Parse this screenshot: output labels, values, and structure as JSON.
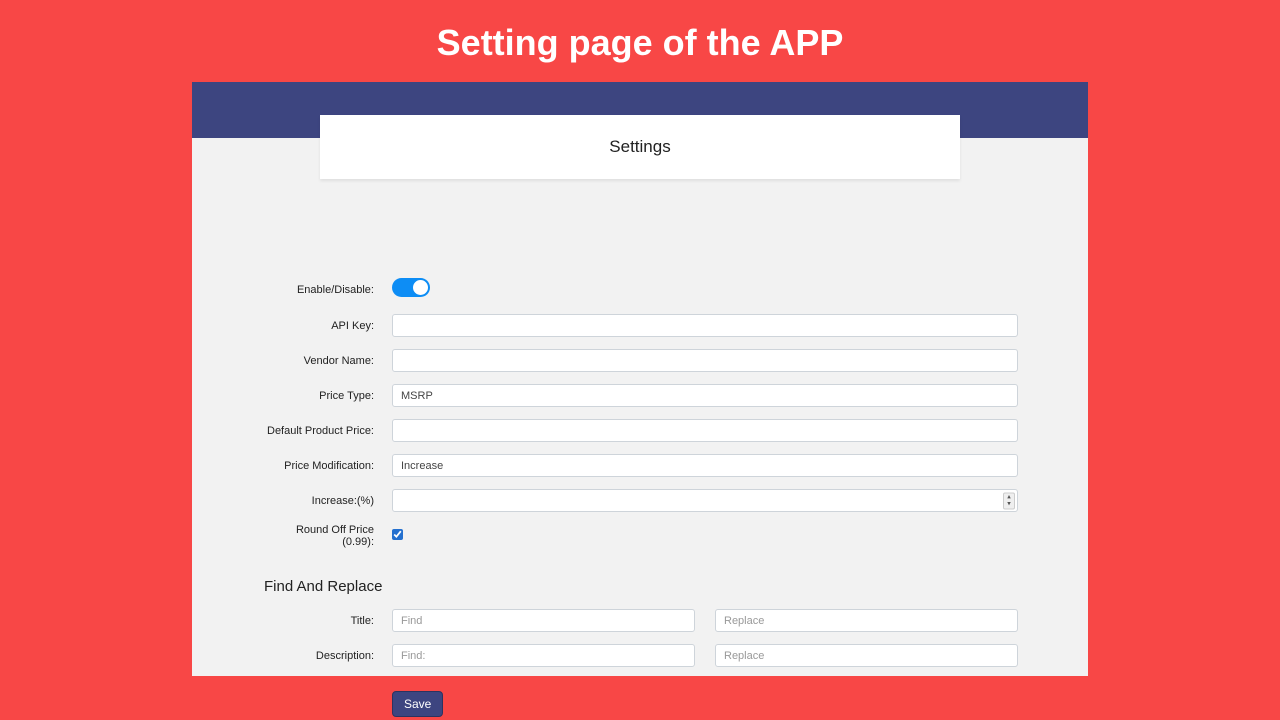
{
  "pageTitle": "Setting page of the APP",
  "card": {
    "title": "Settings"
  },
  "form": {
    "enableDisable": {
      "label": "Enable/Disable:",
      "on": true
    },
    "apiKey": {
      "label": "API Key:",
      "value": ""
    },
    "vendorName": {
      "label": "Vendor Name:",
      "value": ""
    },
    "priceType": {
      "label": "Price Type:",
      "value": "MSRP"
    },
    "defaultProductPrice": {
      "label": "Default Product Price:",
      "value": ""
    },
    "priceModification": {
      "label": "Price Modification:",
      "value": "Increase"
    },
    "increasePct": {
      "label": "Increase:(%)",
      "value": ""
    },
    "roundOff": {
      "label": "Round Off Price (0.99):",
      "checked": true
    }
  },
  "findReplace": {
    "sectionTitle": "Find And Replace",
    "title": {
      "label": "Title:",
      "findPlaceholder": "Find",
      "findValue": "",
      "replacePlaceholder": "Replace",
      "replaceValue": ""
    },
    "description": {
      "label": "Description:",
      "findPlaceholder": "Find:",
      "findValue": "",
      "replacePlaceholder": "Replace",
      "replaceValue": ""
    }
  },
  "actions": {
    "saveLabel": "Save"
  }
}
